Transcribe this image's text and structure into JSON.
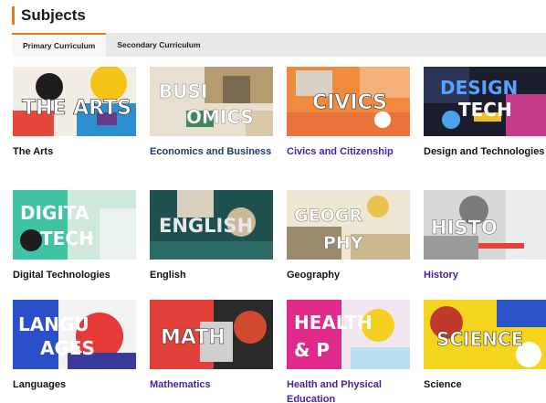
{
  "header": {
    "title": "Subjects",
    "accent_color": "#e87722"
  },
  "tabs": [
    {
      "label": "Primary Curriculum",
      "active": true
    },
    {
      "label": "Secondary Curriculum",
      "active": false
    }
  ],
  "subjects": [
    {
      "name": "The Arts",
      "thumb_text": "THE ARTS",
      "link_color": "dark"
    },
    {
      "name": "Economics and Business",
      "thumb_text": "BUSINESS ECONOMICS",
      "link_color": "navy"
    },
    {
      "name": "Civics and Citizenship",
      "thumb_text": "CIVICS",
      "link_color": "purple"
    },
    {
      "name": "Design and Technologies",
      "thumb_text": "DESIGN TECH",
      "link_color": "dark"
    },
    {
      "name": "Digital Technologies",
      "thumb_text": "DIGITAL TECH",
      "link_color": "dark"
    },
    {
      "name": "English",
      "thumb_text": "ENGLISH",
      "link_color": "dark"
    },
    {
      "name": "Geography",
      "thumb_text": "GEOGRAPHY",
      "link_color": "dark"
    },
    {
      "name": "History",
      "thumb_text": "HISTORY",
      "link_color": "purple"
    },
    {
      "name": "Languages",
      "thumb_text": "LANGUAGES",
      "link_color": "dark"
    },
    {
      "name": "Mathematics",
      "thumb_text": "MATHS",
      "link_color": "purple"
    },
    {
      "name": "Health and Physical Education",
      "thumb_text": "HEALTH & PE",
      "link_color": "purple"
    },
    {
      "name": "Science",
      "thumb_text": "SCIENCE",
      "link_color": "dark"
    }
  ]
}
